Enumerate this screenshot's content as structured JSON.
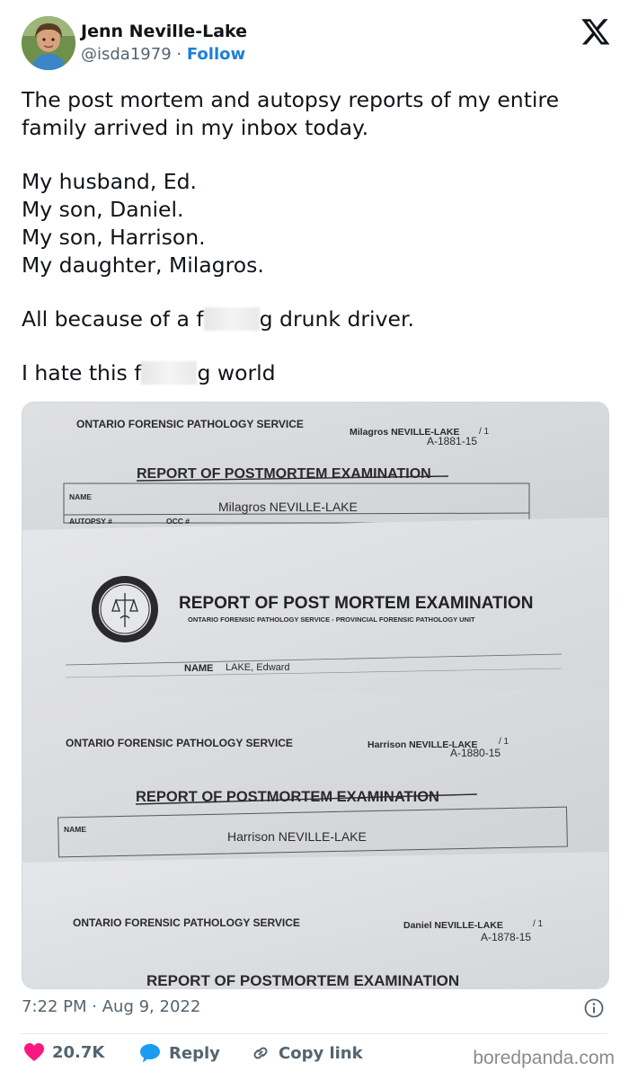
{
  "author": {
    "name": "Jenn Neville-Lake",
    "handle": "@isda1979",
    "separator": "·",
    "follow_label": "Follow"
  },
  "tweet": {
    "line1": "The post mortem and autopsy reports of my entire",
    "line2": "family arrived in my inbox today.",
    "line3": "My husband, Ed.",
    "line4": "My son, Daniel.",
    "line5": "My son, Harrison.",
    "line6": "My daughter, Milagros.",
    "line7_pre": "All because of a f",
    "line7_post": "g drunk driver.",
    "line8_pre": "I hate this f",
    "line8_post": "g world"
  },
  "photo": {
    "report1": {
      "agency": "ONTARIO FORENSIC PATHOLOGY SERVICE",
      "patient": "Milagros NEVILLE-LAKE",
      "page": "/ 1",
      "case_no": "A-1881-15",
      "title": "REPORT OF POSTMORTEM EXAMINATION",
      "name_label": "NAME",
      "name_value": "Milagros NEVILLE-LAKE",
      "autopsy_label": "AUTOPSY #",
      "occ_label": "OCC #"
    },
    "report2": {
      "title": "REPORT OF POST MORTEM EXAMINATION",
      "subtitle": "ONTARIO FORENSIC PATHOLOGY SERVICE - PROVINCIAL FORENSIC PATHOLOGY UNIT",
      "name_label": "NAME",
      "name_value": "LAKE, Edward"
    },
    "report3": {
      "agency": "ONTARIO FORENSIC PATHOLOGY SERVICE",
      "patient": "Harrison NEVILLE-LAKE",
      "page": "/ 1",
      "case_no": "A-1880-15",
      "title": "REPORT OF POSTMORTEM EXAMINATION",
      "name_label": "NAME",
      "name_value": "Harrison NEVILLE-LAKE"
    },
    "report4": {
      "agency": "ONTARIO FORENSIC PATHOLOGY SERVICE",
      "patient": "Daniel NEVILLE-LAKE",
      "page": "/ 1",
      "case_no": "A-1878-15",
      "title": "REPORT OF POSTMORTEM EXAMINATION"
    }
  },
  "meta": {
    "time": "7:22 PM",
    "separator": "·",
    "date": "Aug 9, 2022"
  },
  "actions": {
    "likes": "20.7K",
    "reply_label": "Reply",
    "copy_label": "Copy link"
  },
  "watermark": "boredpanda.com",
  "colors": {
    "accent": "#1d9bf0",
    "like": "#f91880",
    "text": "#0f1419",
    "muted": "#536471"
  },
  "icons": {
    "logo": "x-logo-icon",
    "info": "info-icon",
    "like": "heart-icon",
    "reply": "reply-bubble-icon",
    "copy": "link-icon"
  }
}
